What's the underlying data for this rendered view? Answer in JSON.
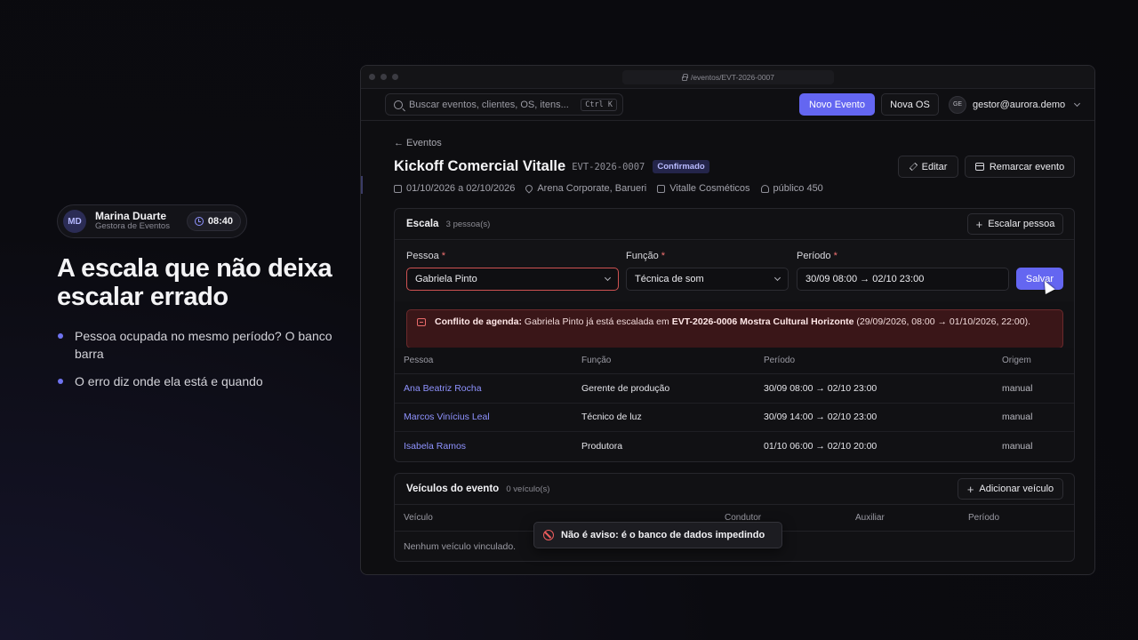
{
  "presenter": {
    "initials": "MD",
    "name": "Marina Duarte",
    "role": "Gestora de Eventos",
    "time": "08:40"
  },
  "slide": {
    "headline": "A escala que não deixa escalar errado",
    "bullets": [
      "Pessoa ocupada no mesmo período? O banco barra",
      "O erro diz onde ela está e quando"
    ]
  },
  "browser": {
    "url": "/eventos/EVT-2026-0007"
  },
  "appbar": {
    "search_placeholder": "Buscar eventos, clientes, OS, itens...",
    "search_shortcut": "Ctrl K",
    "new_event_label": "Novo Evento",
    "new_os_label": "Nova OS",
    "user_initials": "GE",
    "user_email": "gestor@aurora.demo"
  },
  "event": {
    "back_label": "← Eventos",
    "title": "Kickoff Comercial Vitalle",
    "code": "EVT-2026-0007",
    "status": "Confirmado",
    "edit_label": "Editar",
    "reschedule_label": "Remarcar evento",
    "dates": "01/10/2026 a 02/10/2026",
    "venue": "Arena Corporate, Barueri",
    "client": "Vitalle Cosméticos",
    "audience": "público 450"
  },
  "escala": {
    "title": "Escala",
    "count": "3 pessoa(s)",
    "add_label": "Escalar pessoa",
    "form": {
      "person_label": "Pessoa",
      "person_value": "Gabriela Pinto",
      "role_label": "Função",
      "role_value": "Técnica de som",
      "period_label": "Período",
      "period_value": "30/09 08:00 → 02/10 23:00",
      "required_mark": "*",
      "save_label": "Salvar"
    },
    "conflict": {
      "prefix": "Conflito de agenda:",
      "text": "Gabriela Pinto já está escalada em",
      "event": "EVT-2026-0006 Mostra Cultural Horizonte",
      "when": "(29/09/2026, 08:00 → 01/10/2026, 22:00)."
    },
    "columns": [
      "Pessoa",
      "Função",
      "Período",
      "Origem"
    ],
    "rows": [
      {
        "person": "Ana Beatriz Rocha",
        "role": "Gerente de produção",
        "period": "30/09 08:00 → 02/10 23:00",
        "origin": "manual"
      },
      {
        "person": "Marcos Vinícius Leal",
        "role": "Técnico de luz",
        "period": "30/09 14:00 → 02/10 23:00",
        "origin": "manual"
      },
      {
        "person": "Isabela Ramos",
        "role": "Produtora",
        "period": "01/10 06:00 → 02/10 20:00",
        "origin": "manual"
      }
    ]
  },
  "vehicles": {
    "title": "Veículos do evento",
    "count": "0 veículo(s)",
    "add_label": "Adicionar veículo",
    "columns": [
      "Veículo",
      "Condutor",
      "Auxiliar",
      "Período"
    ],
    "empty": "Nenhum veículo vinculado."
  },
  "toast": {
    "text": "Não é aviso: é o banco de dados impedindo"
  },
  "colors": {
    "accent": "#6466f1",
    "error": "#cf5252",
    "link": "#8f93ff"
  }
}
